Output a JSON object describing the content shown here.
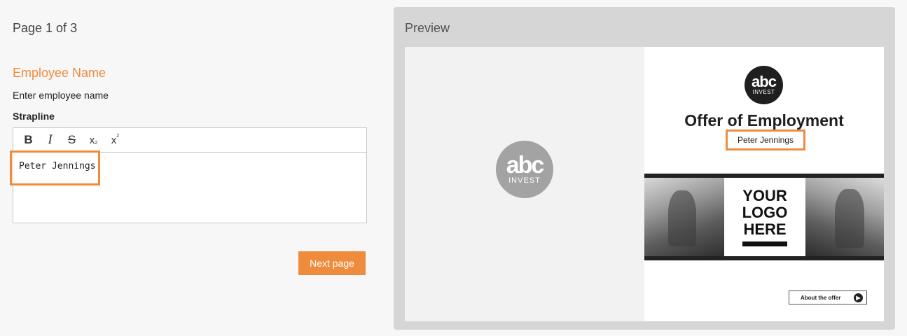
{
  "form": {
    "page_indicator": "Page 1 of 3",
    "section_title": "Employee Name",
    "help_text": "Enter employee name",
    "field_label": "Strapline",
    "editor_value": "Peter Jennings",
    "toolbar": {
      "bold": "B",
      "italic": "I",
      "strike": "S",
      "subscript": "x",
      "superscript": "x"
    },
    "next_button": "Next page"
  },
  "preview": {
    "title": "Preview",
    "logo_abc": "abc",
    "logo_invest": "INVEST",
    "offer_title": "Offer of Employment",
    "employee_name": "Peter Jennings",
    "logo_placeholder": "YOUR LOGO HERE",
    "about_button": "About the offer"
  },
  "colors": {
    "accent": "#ef8b3c",
    "preview_bg": "#d6d6d6"
  },
  "icons": [
    "bold-icon",
    "italic-icon",
    "strikethrough-icon",
    "subscript-icon",
    "superscript-icon",
    "arrow-right-icon"
  ]
}
